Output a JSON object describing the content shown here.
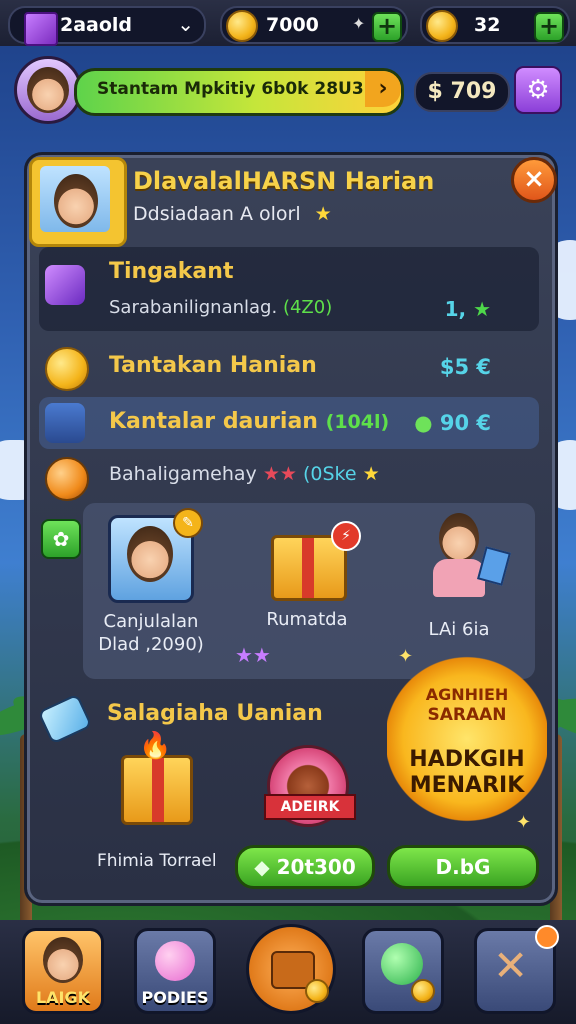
{
  "topbar": {
    "gem_label": "2aaold",
    "coins_value": "7000",
    "gold_value": "32",
    "plus_label": "+",
    "dropdown_icon": "chevron-down-icon"
  },
  "header": {
    "banner_text": "Stantam Mpkitiy 6b0k 28U3",
    "banner_arrow": "›",
    "money": "$ 709",
    "settings_icon": "gear-icon"
  },
  "panel": {
    "title": "DlavalalHARSN Harian",
    "subtitle": "Ddsiadaan A olorl",
    "subtitle_star": "★",
    "close_label": "×",
    "rows": [
      {
        "label": "Tingakant",
        "sub": "Sarabanilignanlag.",
        "sub_hl": "(4Z0)",
        "value": "1,",
        "value_icon": "★"
      },
      {
        "label": "Tantakan Hanian",
        "value": "$5 €"
      },
      {
        "label": "Kantalar daurian",
        "label_hl": "(104l)",
        "value": "90 €"
      },
      {
        "sub": "Bahaligamehay",
        "sub_hl": "(0Ske",
        "stars": "★★"
      }
    ],
    "rewards": [
      {
        "name_line1": "Canjulalan",
        "name_line2": "Dlad ,2090)",
        "stars": "★★"
      },
      {
        "name_line1": "Rumatda"
      },
      {
        "name_line1": "LAi 6ia"
      }
    ],
    "daily": {
      "title": "Salagiaha Uanian",
      "card1_label": "Fhimia Torrael",
      "card2_label": "ADEIRK",
      "btn1_label": "20t300",
      "btn2_label": "D.bG"
    },
    "burst": {
      "line1": "AGNHIEH",
      "line2": "SARAAN",
      "line3": "HADKGIH",
      "line4": "MENARIK"
    }
  },
  "nav": [
    {
      "label": "LAIGK",
      "color": "#f2a51e"
    },
    {
      "label": "PODIES",
      "color": "#5a6a9a"
    },
    {
      "label": "",
      "color": "#e07a1a"
    },
    {
      "label": "",
      "color": "#4a5a8a"
    },
    {
      "label": "",
      "color": "#4a5a8a"
    }
  ]
}
